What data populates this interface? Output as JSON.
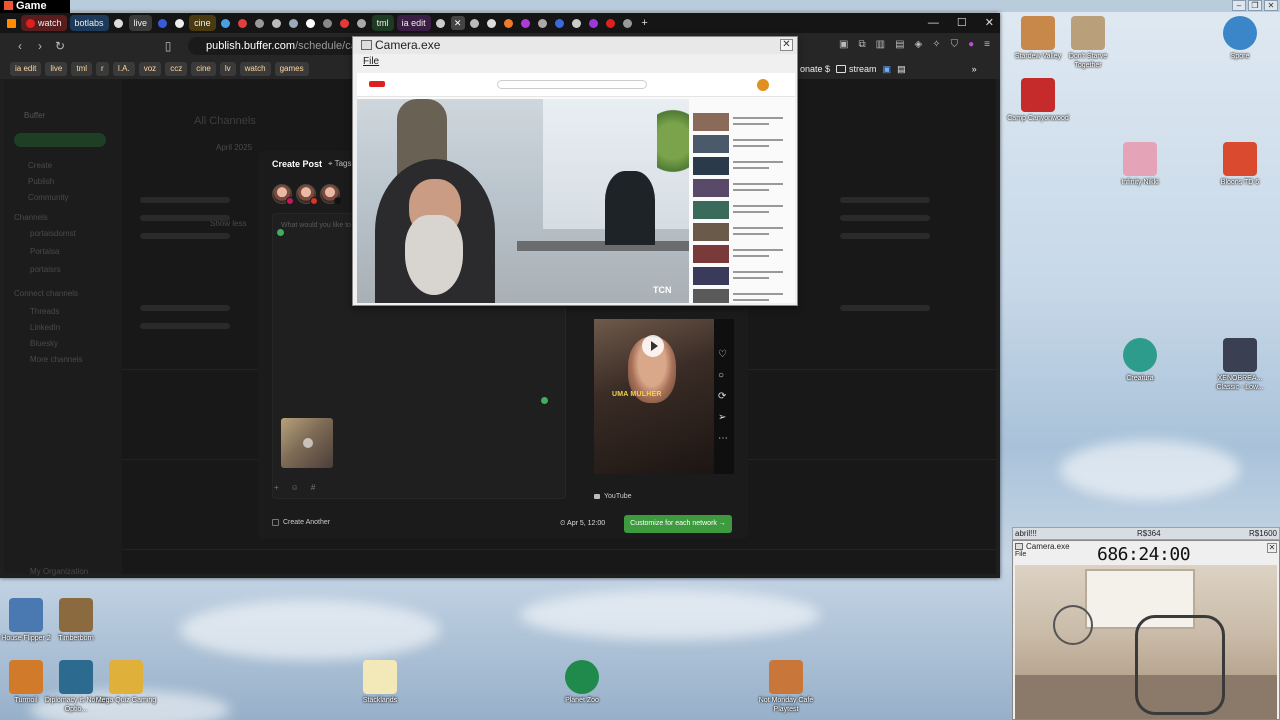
{
  "game_bar": {
    "title": "Game"
  },
  "browser": {
    "tabs": [
      {
        "label": "watch",
        "color": "#e02020"
      },
      {
        "label": "botlabs",
        "color": "#1a73e8"
      },
      {
        "label": "live",
        "color": "#888888"
      },
      {
        "label": "cine",
        "color": "#e0a000"
      },
      {
        "label": "tml",
        "color": "#2e7d32"
      },
      {
        "label": "ia edit",
        "color": "#6a1b9a"
      }
    ],
    "url_host": "publish.buffer.com",
    "url_path": "/schedule/calenc",
    "bookmarks": [
      "ia edit",
      "live",
      "tml",
      "r",
      "I.A.",
      "voz",
      "ccz",
      "cine",
      "lv",
      "watch",
      "games"
    ],
    "bookmarks_right": [
      "onate $",
      "stream"
    ]
  },
  "buffer": {
    "logo": "Buffer",
    "channels_title": "All Channels",
    "month": "April 2025",
    "sidebar": [
      "Create",
      "Publish",
      "Community",
      "Channels",
      "portaisdomst",
      "Portaisa",
      "portaisrs",
      "Show less",
      "Connect channels",
      "Threads",
      "LinkedIn",
      "Bluesky",
      "More channels"
    ],
    "org": "My Organization"
  },
  "create_post": {
    "title": "Create Post",
    "tags": "Tags",
    "placeholder": "What would you like to share?",
    "create_another": "Create Another",
    "schedule": "Apr 5, 12:00",
    "cta": "Customize for each network →",
    "preview_network": "YouTube",
    "preview_caption": "UMA MULHER"
  },
  "camera_window": {
    "title": "Camera.exe",
    "menu_file": "File",
    "watermark": "TCN"
  },
  "desktop_icons": [
    {
      "label": "Stardew Valley",
      "color": "#c8884a"
    },
    {
      "label": "Don't Starve Together",
      "color": "#b9a07a"
    },
    {
      "label": "Spore",
      "color": "#3a86c8"
    },
    {
      "label": "Camp Canyonwood",
      "color": "#c62b2b"
    },
    {
      "label": "Infinity Nikki",
      "color": "#e5a3b8"
    },
    {
      "label": "Bloons TD 6",
      "color": "#d94a2f"
    },
    {
      "label": "Creatura",
      "color": "#2e9c8c"
    },
    {
      "label": "XENOBREA... Classic - Low...",
      "color": "#3b3f52"
    },
    {
      "label": "House Flipper 2",
      "color": "#4a78b0"
    },
    {
      "label": "Timberborn",
      "color": "#8b6a3f"
    },
    {
      "label": "Turmoil",
      "color": "#d07a2a"
    },
    {
      "label": "Diplomacy is Not an Optio...",
      "color": "#2c6b8f"
    },
    {
      "label": "Mega Quiz Gaming",
      "color": "#e0b13a"
    },
    {
      "label": "Stacklands",
      "color": "#f3e9b8"
    },
    {
      "label": "Planet Zoo",
      "color": "#1f8a4c"
    },
    {
      "label": "Not Monday Cafe Playtest",
      "color": "#c9763a"
    }
  ],
  "timer_panel": {
    "left_label": "abril!!!",
    "mid_label": "R$364",
    "right_label": "R$1600",
    "camera_title": "Camera.exe",
    "menu": "File",
    "timer": "686:24:00"
  }
}
